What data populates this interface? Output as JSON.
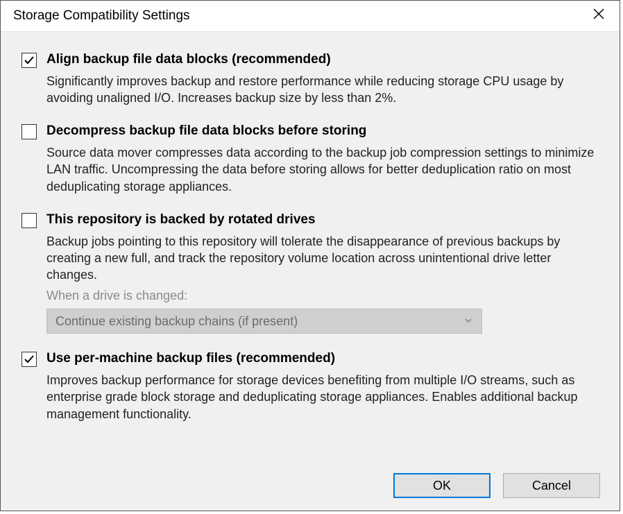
{
  "window": {
    "title": "Storage Compatibility Settings"
  },
  "options": {
    "align": {
      "checked": true,
      "title": "Align backup file data blocks (recommended)",
      "desc": "Significantly improves backup and restore performance while reducing storage CPU usage by avoiding unaligned I/O. Increases backup size by less than 2%."
    },
    "decompress": {
      "checked": false,
      "title": "Decompress backup file data blocks before storing",
      "desc": "Source data mover compresses data according to the backup job compression settings to minimize LAN traffic. Uncompressing the data before storing allows for better deduplication ratio on most deduplicating storage appliances."
    },
    "rotated": {
      "checked": false,
      "title": "This repository is backed by rotated drives",
      "desc": "Backup jobs pointing to this repository will tolerate the disappearance of previous backups by creating a new full, and track the repository volume location across unintentional drive letter changes.",
      "sub_label": "When a drive is changed:",
      "select_value": "Continue existing backup chains (if present)"
    },
    "per_machine": {
      "checked": true,
      "title": "Use per-machine backup files (recommended)",
      "desc": "Improves backup performance for storage devices benefiting from multiple I/O streams, such as enterprise grade block storage and deduplicating storage appliances. Enables additional backup management functionality."
    }
  },
  "buttons": {
    "ok": "OK",
    "cancel": "Cancel"
  }
}
